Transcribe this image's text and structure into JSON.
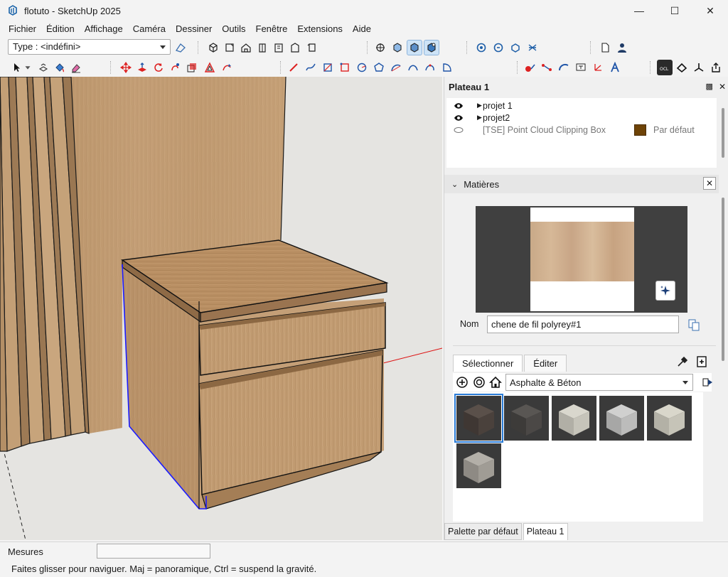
{
  "window": {
    "title": "flotuto - SketchUp 2025"
  },
  "menu": [
    "Fichier",
    "Édition",
    "Affichage",
    "Caméra",
    "Dessiner",
    "Outils",
    "Fenêtre",
    "Extensions",
    "Aide"
  ],
  "toolbar": {
    "type_value": "Type : <indéfini>"
  },
  "plateau": {
    "title": "Plateau 1",
    "tags": [
      {
        "name": "projet 1",
        "visible": true,
        "expandable": true
      },
      {
        "name": "projet2",
        "visible": true,
        "expandable": true
      },
      {
        "name": "[TSE] Point Cloud Clipping Box",
        "visible": false,
        "expandable": false,
        "color": "#6e4307",
        "dash": "Par défaut"
      }
    ]
  },
  "materials": {
    "title": "Matières",
    "name_label": "Nom",
    "name_value": "chene de fil polyrey#1",
    "tabs": [
      "Sélectionner",
      "Éditer"
    ],
    "library": "Asphalte & Béton",
    "swatch_colors": [
      "#4f4640",
      "#4c4a48",
      "#c8c6bd",
      "#bdbdbb",
      "#c9c7bb",
      "#a19d96"
    ]
  },
  "bottom_tabs": [
    "Palette par défaut",
    "Plateau 1"
  ],
  "measure": {
    "label": "Mesures",
    "value": ""
  },
  "status": {
    "text": "Faites glisser pour naviguer. Maj = panoramique, Ctrl =  suspend la gravité."
  }
}
